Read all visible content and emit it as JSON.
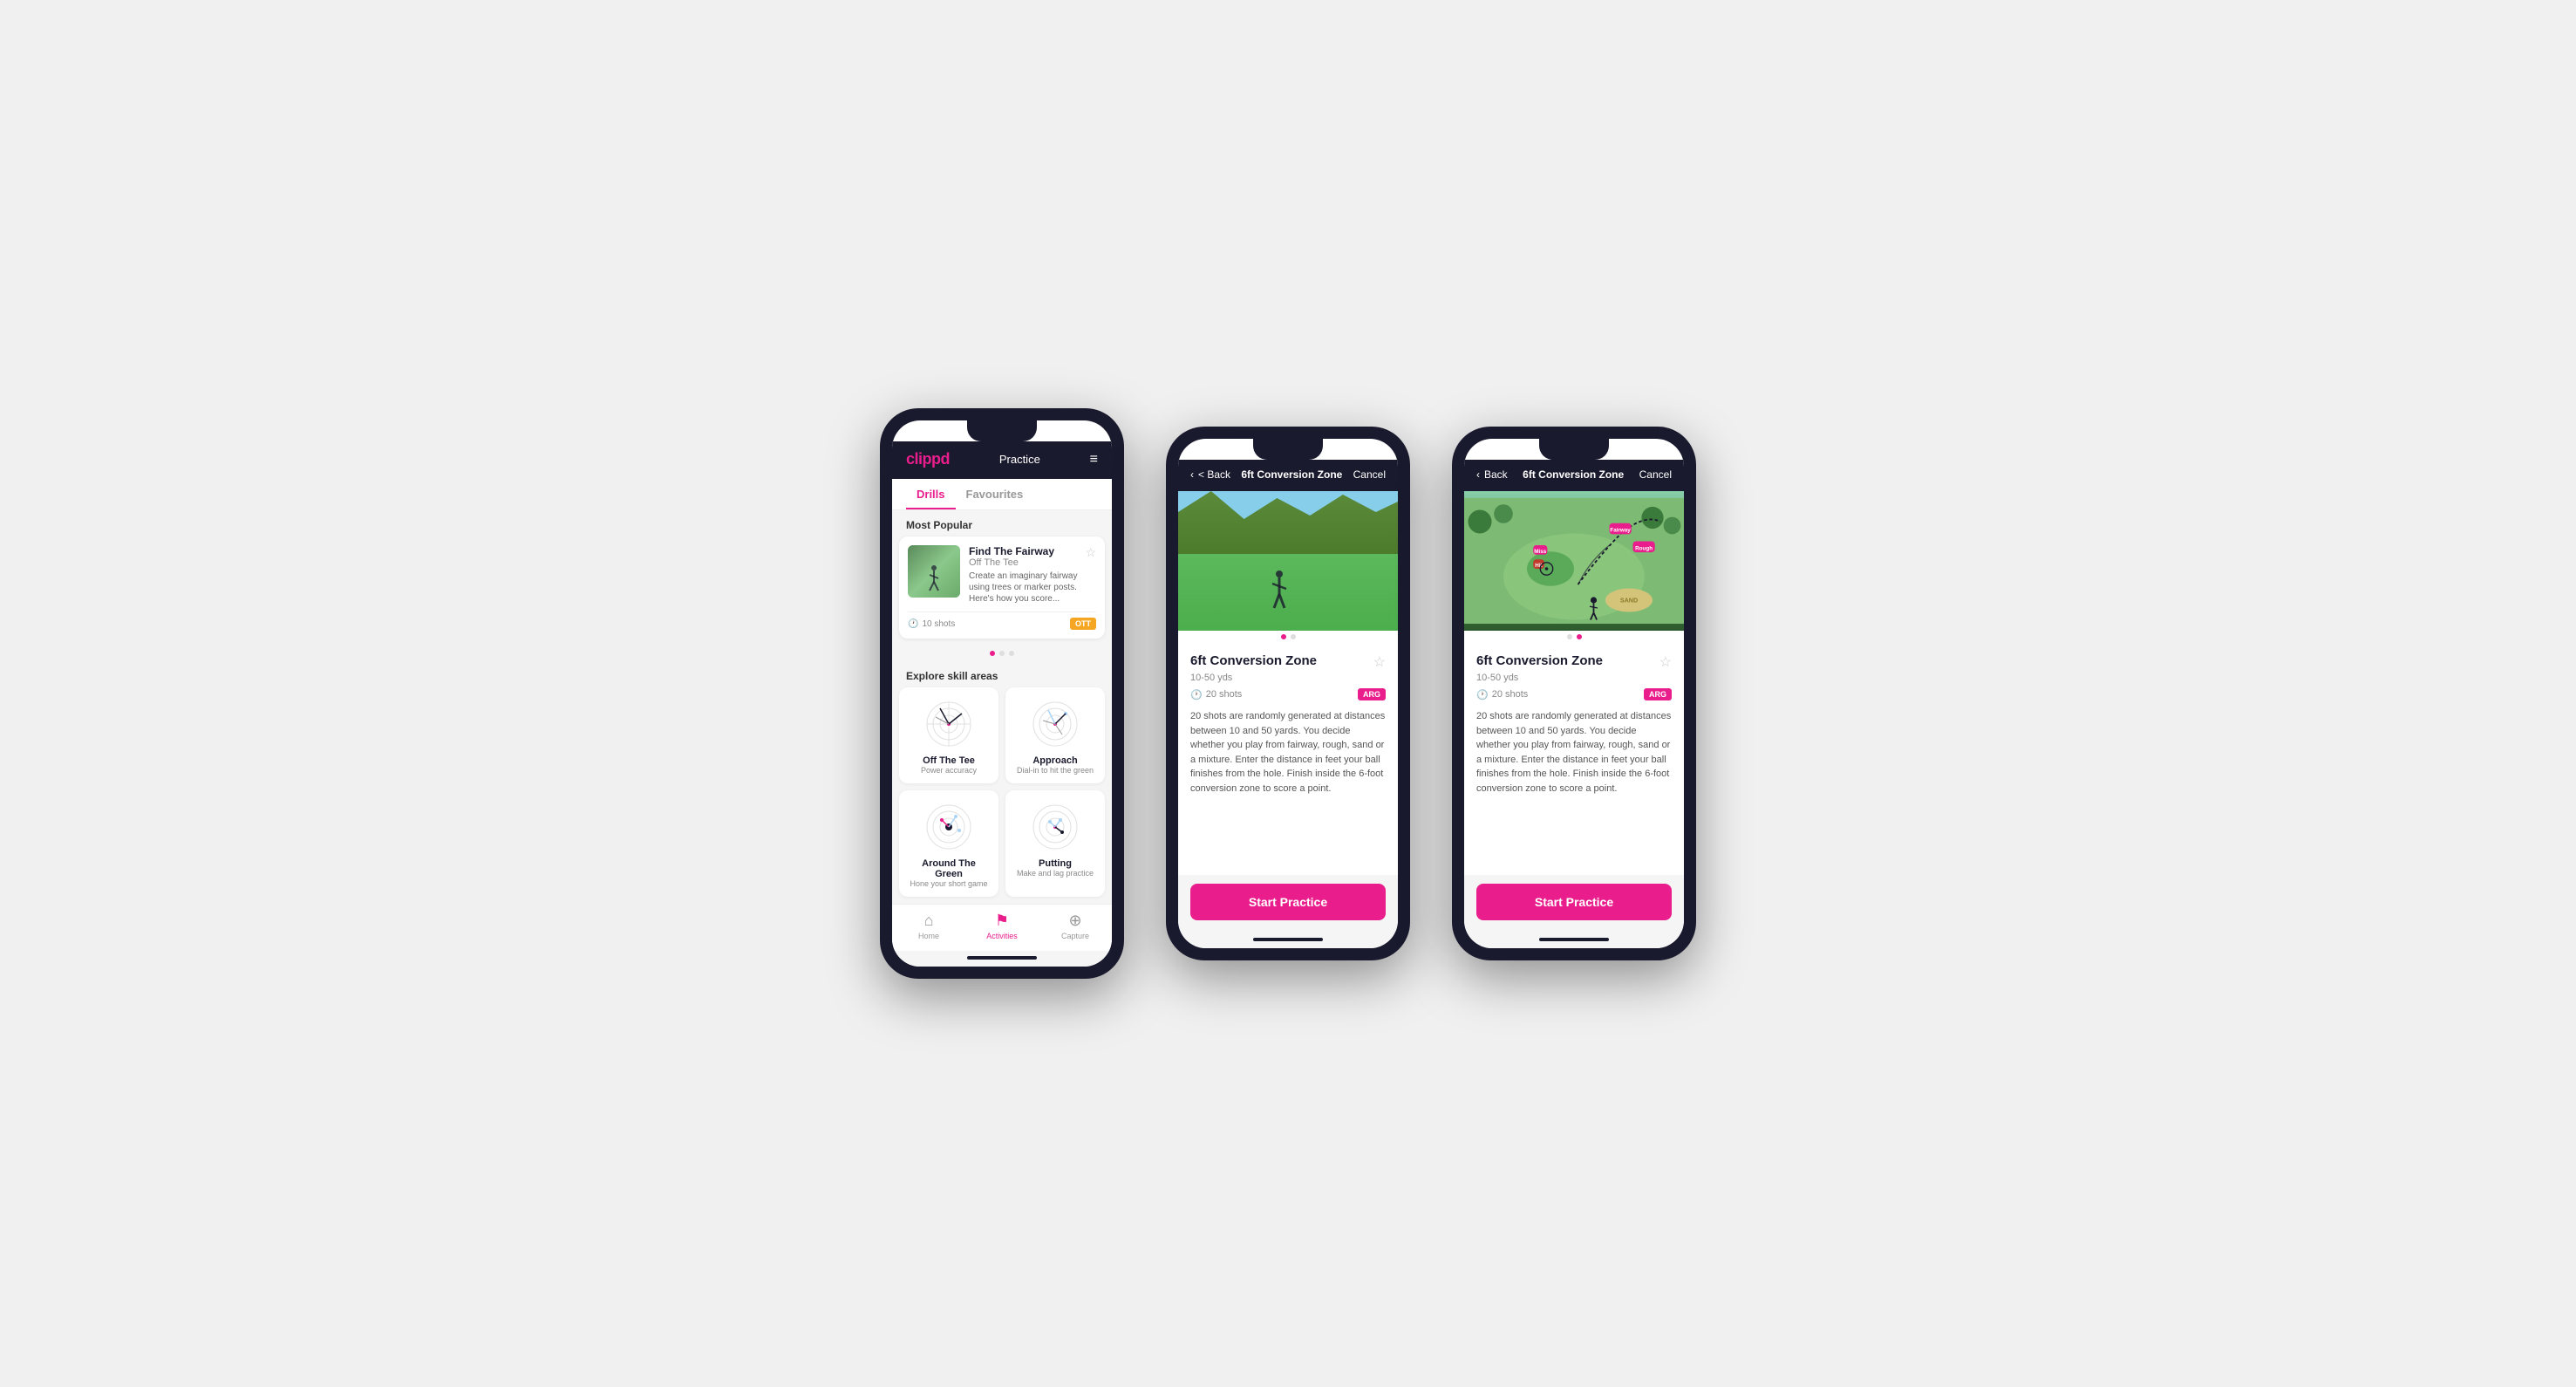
{
  "app": {
    "logo": "clippd",
    "nav_title": "Practice",
    "hamburger_icon": "≡"
  },
  "screen1": {
    "tabs": [
      {
        "label": "Drills",
        "active": true
      },
      {
        "label": "Favourites",
        "active": false
      }
    ],
    "most_popular_label": "Most Popular",
    "featured_drill": {
      "name": "Find The Fairway",
      "category": "Off The Tee",
      "description": "Create an imaginary fairway using trees or marker posts. Here's how you score...",
      "shots": "10 shots",
      "tag": "OTT"
    },
    "explore_label": "Explore skill areas",
    "skills": [
      {
        "name": "Off The Tee",
        "sub": "Power accuracy"
      },
      {
        "name": "Approach",
        "sub": "Dial-in to hit the green"
      },
      {
        "name": "Around The Green",
        "sub": "Hone your short game"
      },
      {
        "name": "Putting",
        "sub": "Make and lag practice"
      }
    ],
    "nav": [
      {
        "icon": "⌂",
        "label": "Home",
        "active": false
      },
      {
        "icon": "♟",
        "label": "Activities",
        "active": true
      },
      {
        "icon": "⊕",
        "label": "Capture",
        "active": false
      }
    ]
  },
  "screen2": {
    "back_label": "< Back",
    "title": "6ft Conversion Zone",
    "cancel_label": "Cancel",
    "drill_title": "6ft Conversion Zone",
    "distance": "10-50 yds",
    "shots": "20 shots",
    "tag": "ARG",
    "description": "20 shots are randomly generated at distances between 10 and 50 yards. You decide whether you play from fairway, rough, sand or a mixture. Enter the distance in feet your ball finishes from the hole. Finish inside the 6-foot conversion zone to score a point.",
    "start_label": "Start Practice"
  },
  "screen3": {
    "back_label": "< Back",
    "title": "6ft Conversion Zone",
    "cancel_label": "Cancel",
    "drill_title": "6ft Conversion Zone",
    "distance": "10-50 yds",
    "shots": "20 shots",
    "tag": "ARG",
    "description": "20 shots are randomly generated at distances between 10 and 50 yards. You decide whether you play from fairway, rough, sand or a mixture. Enter the distance in feet your ball finishes from the hole. Finish inside the 6-foot conversion zone to score a point.",
    "start_label": "Start Practice"
  },
  "icons": {
    "clock": "🕐",
    "star": "☆",
    "star_filled": "★",
    "chevron_left": "‹",
    "home": "⌂",
    "activities": "♟",
    "capture": "⊕"
  }
}
